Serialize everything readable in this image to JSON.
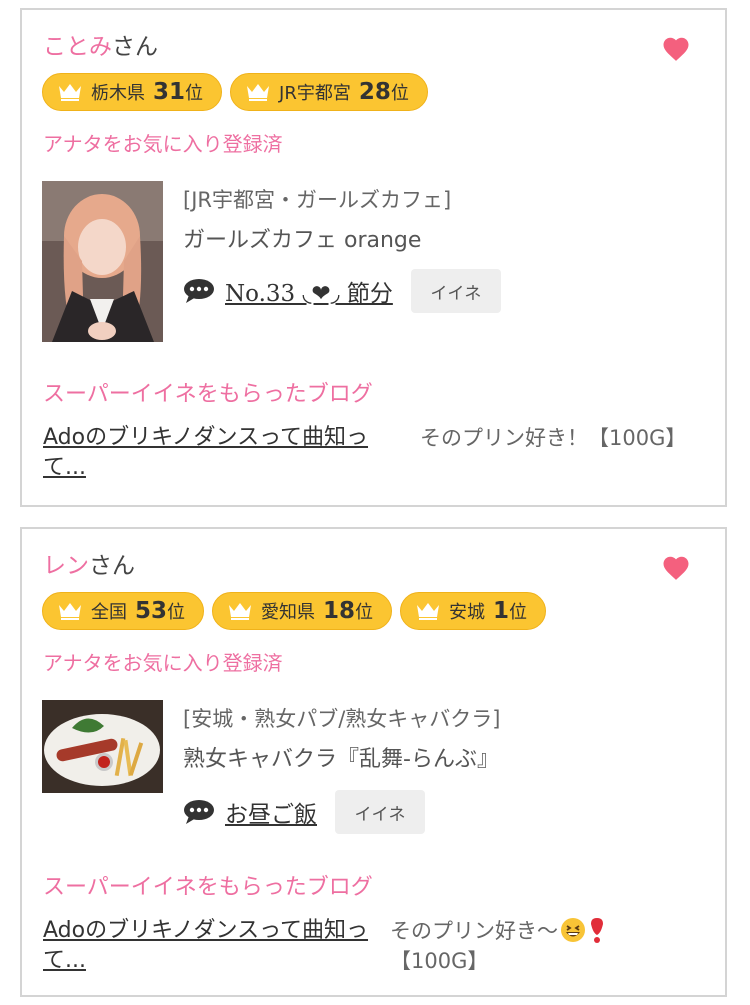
{
  "cards": [
    {
      "name": "ことみ",
      "name_suffix": "さん",
      "badges": [
        {
          "label": "栃木県",
          "rank": "31",
          "unit": "位"
        },
        {
          "label": "JR宇都宮",
          "rank": "28",
          "unit": "位"
        }
      ],
      "favorite_status": "アナタをお気に入り登録済",
      "shop_category": "[JR宇都宮・ガールズカフェ]",
      "shop_name": "ガールズカフェ orange",
      "blog_title": "No.33 ◟❤︎◞ 節分",
      "iine_label": "イイネ",
      "super_iine_heading": "スーパーイイネをもらったブログ",
      "liked_blog_title": "Adoのブリキノダンスって曲知って...",
      "liked_comment": "そのプリン好き！【100G】"
    },
    {
      "name": "レン",
      "name_suffix": "さん",
      "badges": [
        {
          "label": "全国",
          "rank": "53",
          "unit": "位"
        },
        {
          "label": "愛知県",
          "rank": "18",
          "unit": "位"
        },
        {
          "label": "安城",
          "rank": "1",
          "unit": "位"
        }
      ],
      "favorite_status": "アナタをお気に入り登録済",
      "shop_category": "[安城・熟女パブ/熟女キャバクラ]",
      "shop_name": "熟女キャバクラ『乱舞-らんぶ』",
      "blog_title": "お昼ご飯",
      "iine_label": "イイネ",
      "super_iine_heading": "スーパーイイネをもらったブログ",
      "liked_blog_title": "Adoのブリキノダンスって曲知って...",
      "liked_comment_text": "そのプリン好き〜",
      "liked_comment_price": "【100G】"
    }
  ],
  "colors": {
    "accent_pink": "#ee6fa1",
    "badge_yellow": "#fbc531",
    "heart": "#f4607e"
  },
  "icons": [
    "heart-icon",
    "crown-icon",
    "speech-bubble-icon",
    "grin-emoji-icon",
    "exclamation-emoji-icon"
  ]
}
